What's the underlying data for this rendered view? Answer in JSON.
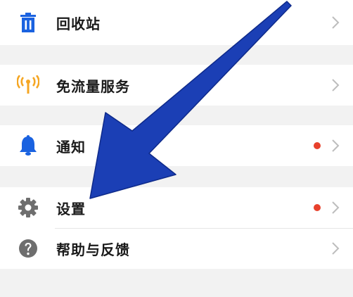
{
  "menu": {
    "items": [
      {
        "label": "回收站",
        "icon": "trash-icon",
        "icon_color": "#1a62e0",
        "badge": false
      },
      {
        "label": "免流量服务",
        "icon": "signal-tower-icon",
        "icon_color": "#f5a623",
        "badge": false
      },
      {
        "label": "通知",
        "icon": "bell-icon",
        "icon_color": "#1a62e0",
        "badge": true
      },
      {
        "label": "设置",
        "icon": "gear-icon",
        "icon_color": "#6e6e6e",
        "badge": true
      },
      {
        "label": "帮助与反馈",
        "icon": "help-circle-icon",
        "icon_color": "#6e6e6e",
        "badge": false
      }
    ]
  },
  "colors": {
    "badge": "#e8412c",
    "annotation_arrow": "#1b3fb5",
    "chevron": "#bdbdbd"
  },
  "annotation": {
    "icon": "pointer-arrow-icon"
  }
}
